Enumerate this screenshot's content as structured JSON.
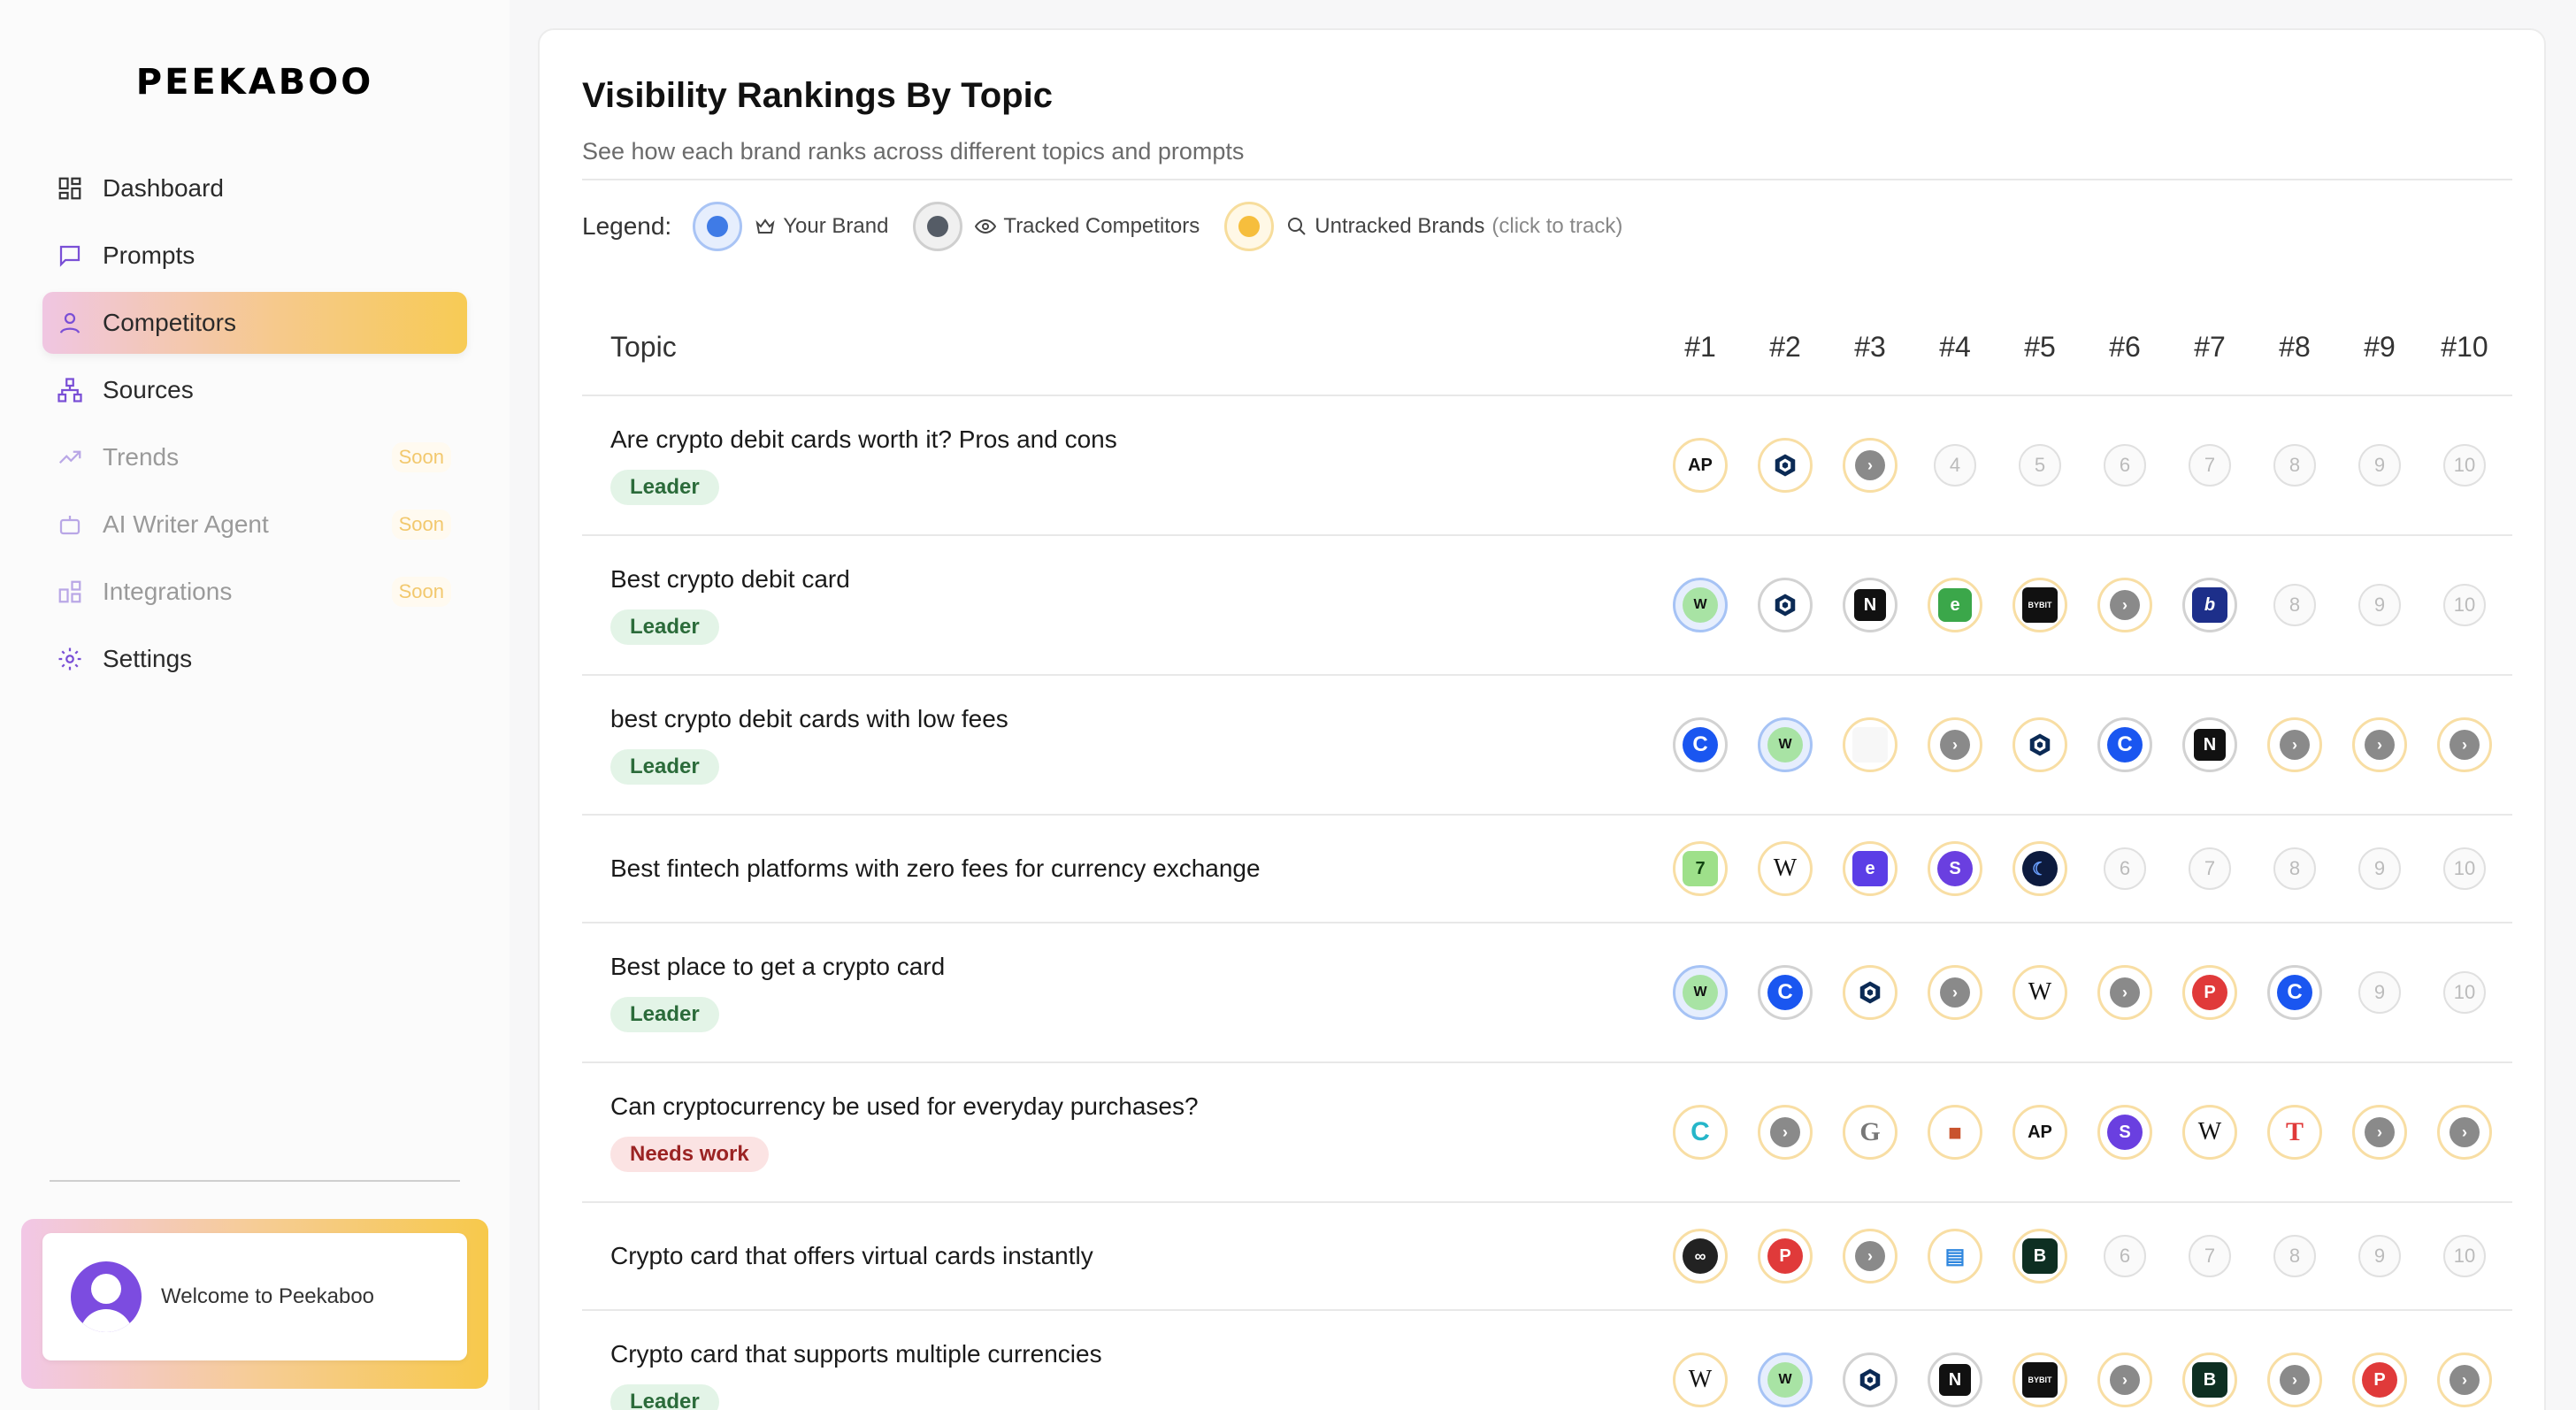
{
  "sidebar": {
    "logo": "PEEKABOO",
    "items": [
      {
        "label": "Dashboard",
        "icon": "dashboard-icon",
        "state": "normal"
      },
      {
        "label": "Prompts",
        "icon": "chat-icon",
        "state": "normal"
      },
      {
        "label": "Competitors",
        "icon": "user-icon",
        "state": "active"
      },
      {
        "label": "Sources",
        "icon": "sitemap-icon",
        "state": "normal"
      },
      {
        "label": "Trends",
        "icon": "trend-icon",
        "state": "disabled",
        "badge": "Soon"
      },
      {
        "label": "AI Writer Agent",
        "icon": "bot-icon",
        "state": "disabled",
        "badge": "Soon"
      },
      {
        "label": "Integrations",
        "icon": "puzzle-icon",
        "state": "disabled",
        "badge": "Soon"
      },
      {
        "label": "Settings",
        "icon": "gear-icon",
        "state": "normal"
      }
    ],
    "welcome": "Welcome to Peekaboo"
  },
  "main": {
    "title": "Visibility Rankings By Topic",
    "subtitle": "See how each brand ranks across different topics and prompts",
    "legend": {
      "label": "Legend:",
      "your_brand": "Your Brand",
      "tracked": "Tracked Competitors",
      "untracked": "Untracked Brands",
      "untracked_hint": "(click to track)"
    },
    "table": {
      "topic_header": "Topic",
      "rank_headers": [
        "#1",
        "#2",
        "#3",
        "#4",
        "#5",
        "#6",
        "#7",
        "#8",
        "#9",
        "#10"
      ],
      "rows": [
        {
          "topic": "Are crypto debit cards worth it? Pros and cons",
          "badge": "Leader",
          "badge_type": "leader",
          "ranks": [
            {
              "t": "yellow",
              "k": "ap"
            },
            {
              "t": "yellow",
              "k": "cro"
            },
            {
              "t": "yellow",
              "k": "arrow"
            },
            {
              "t": "empty",
              "n": "4"
            },
            {
              "t": "empty",
              "n": "5"
            },
            {
              "t": "empty",
              "n": "6"
            },
            {
              "t": "empty",
              "n": "7"
            },
            {
              "t": "empty",
              "n": "8"
            },
            {
              "t": "empty",
              "n": "9"
            },
            {
              "t": "empty",
              "n": "10"
            }
          ]
        },
        {
          "topic": "Best crypto debit card",
          "badge": "Leader",
          "badge_type": "leader",
          "ranks": [
            {
              "t": "blue",
              "k": "w"
            },
            {
              "t": "gray",
              "k": "cro"
            },
            {
              "t": "gray",
              "k": "n"
            },
            {
              "t": "yellow",
              "k": "e"
            },
            {
              "t": "yellow",
              "k": "bybit"
            },
            {
              "t": "yellow",
              "k": "arrow"
            },
            {
              "t": "gray",
              "k": "b"
            },
            {
              "t": "empty",
              "n": "8"
            },
            {
              "t": "empty",
              "n": "9"
            },
            {
              "t": "empty",
              "n": "10"
            }
          ]
        },
        {
          "topic": "best crypto debit cards with low fees",
          "badge": "Leader",
          "badge_type": "leader",
          "ranks": [
            {
              "t": "gray",
              "k": "c"
            },
            {
              "t": "blue",
              "k": "w"
            },
            {
              "t": "yellow",
              "k": "blank"
            },
            {
              "t": "yellow",
              "k": "arrow"
            },
            {
              "t": "yellow",
              "k": "cro"
            },
            {
              "t": "gray",
              "k": "c"
            },
            {
              "t": "gray",
              "k": "n"
            },
            {
              "t": "yellow",
              "k": "arrow"
            },
            {
              "t": "yellow",
              "k": "arrow"
            },
            {
              "t": "yellow",
              "k": "arrow"
            }
          ]
        },
        {
          "topic": "Best fintech platforms with zero fees for currency exchange",
          "badge": "",
          "badge_type": "",
          "ranks": [
            {
              "t": "yellow",
              "k": "green7"
            },
            {
              "t": "yellow",
              "k": "wiki"
            },
            {
              "t": "yellow",
              "k": "purple"
            },
            {
              "t": "yellow",
              "k": "violet"
            },
            {
              "t": "yellow",
              "k": "moon"
            },
            {
              "t": "empty",
              "n": "6"
            },
            {
              "t": "empty",
              "n": "7"
            },
            {
              "t": "empty",
              "n": "8"
            },
            {
              "t": "empty",
              "n": "9"
            },
            {
              "t": "empty",
              "n": "10"
            }
          ]
        },
        {
          "topic": "Best place to get a crypto card",
          "badge": "Leader",
          "badge_type": "leader",
          "ranks": [
            {
              "t": "blue",
              "k": "w"
            },
            {
              "t": "gray",
              "k": "c"
            },
            {
              "t": "yellow",
              "k": "cro"
            },
            {
              "t": "yellow",
              "k": "arrow"
            },
            {
              "t": "yellow",
              "k": "wiki"
            },
            {
              "t": "yellow",
              "k": "arrow"
            },
            {
              "t": "yellow",
              "k": "p"
            },
            {
              "t": "gray",
              "k": "c"
            },
            {
              "t": "empty",
              "n": "9"
            },
            {
              "t": "empty",
              "n": "10"
            }
          ]
        },
        {
          "topic": "Can cryptocurrency be used for everyday purchases?",
          "badge": "Needs work",
          "badge_type": "needs",
          "ranks": [
            {
              "t": "yellow",
              "k": "teal"
            },
            {
              "t": "yellow",
              "k": "arrow"
            },
            {
              "t": "yellow",
              "k": "g"
            },
            {
              "t": "yellow",
              "k": "bag"
            },
            {
              "t": "yellow",
              "k": "ap"
            },
            {
              "t": "yellow",
              "k": "violet"
            },
            {
              "t": "yellow",
              "k": "wiki"
            },
            {
              "t": "yellow",
              "k": "t"
            },
            {
              "t": "yellow",
              "k": "arrow"
            },
            {
              "t": "yellow",
              "k": "arrow"
            }
          ]
        },
        {
          "topic": "Crypto card that offers virtual cards instantly",
          "badge": "",
          "badge_type": "",
          "ranks": [
            {
              "t": "yellow",
              "k": "infinity"
            },
            {
              "t": "yellow",
              "k": "p"
            },
            {
              "t": "yellow",
              "k": "arrow"
            },
            {
              "t": "yellow",
              "k": "card"
            },
            {
              "t": "yellow",
              "k": "bgreen"
            },
            {
              "t": "empty",
              "n": "6"
            },
            {
              "t": "empty",
              "n": "7"
            },
            {
              "t": "empty",
              "n": "8"
            },
            {
              "t": "empty",
              "n": "9"
            },
            {
              "t": "empty",
              "n": "10"
            }
          ]
        },
        {
          "topic": "Crypto card that supports multiple currencies",
          "badge": "Leader",
          "badge_type": "leader",
          "ranks": [
            {
              "t": "yellow",
              "k": "wiki"
            },
            {
              "t": "blue",
              "k": "w"
            },
            {
              "t": "gray",
              "k": "cro"
            },
            {
              "t": "gray",
              "k": "n"
            },
            {
              "t": "yellow",
              "k": "bybit"
            },
            {
              "t": "yellow",
              "k": "arrow"
            },
            {
              "t": "yellow",
              "k": "bgreen"
            },
            {
              "t": "yellow",
              "k": "arrow"
            },
            {
              "t": "yellow",
              "k": "p"
            },
            {
              "t": "yellow",
              "k": "arrow"
            }
          ]
        }
      ]
    }
  }
}
